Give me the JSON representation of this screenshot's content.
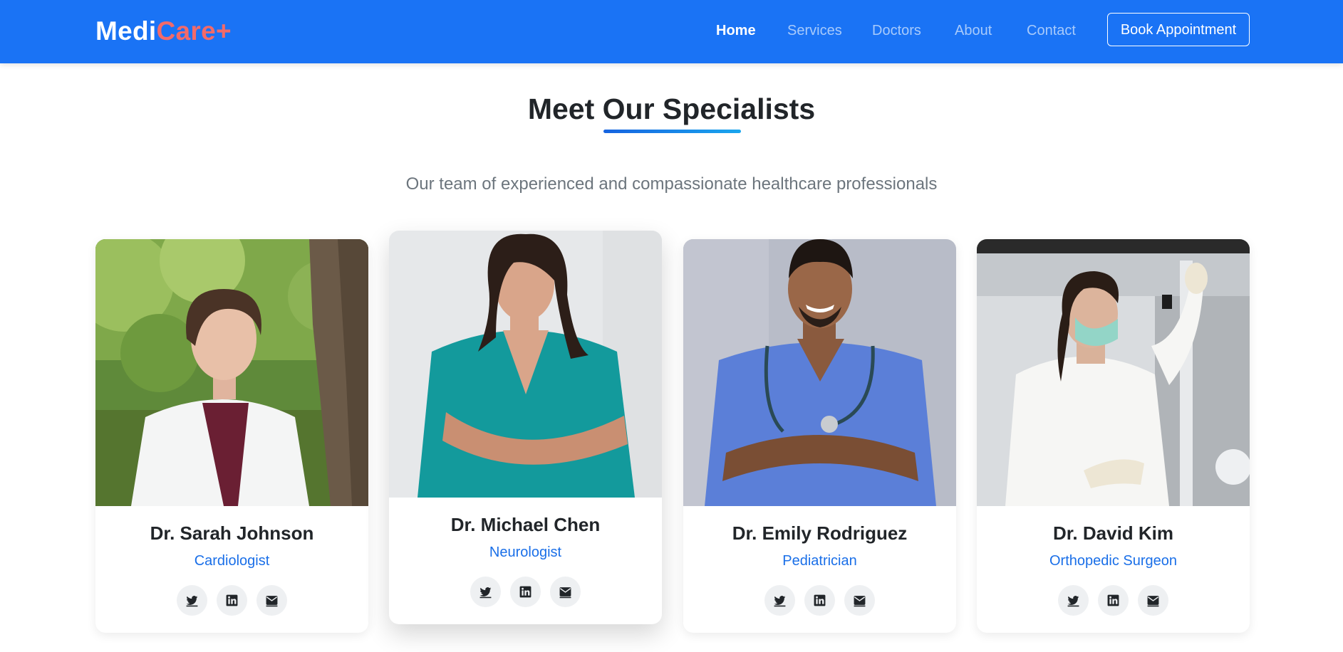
{
  "brand": {
    "part1": "Medi",
    "part2": "Care+"
  },
  "nav": {
    "links": [
      {
        "label": "Home",
        "active": true
      },
      {
        "label": "Services",
        "active": false
      },
      {
        "label": "Doctors",
        "active": false
      },
      {
        "label": "About",
        "active": false
      },
      {
        "label": "Contact",
        "active": false
      }
    ],
    "cta_label": "Book Appointment"
  },
  "section": {
    "title": "Meet Our Specialists",
    "subtitle": "Our team of experienced and compassionate healthcare professionals"
  },
  "doctors": [
    {
      "name": "Dr. Sarah Johnson",
      "role": "Cardiologist",
      "photo": "doctor-photo-outdoor-white-coat"
    },
    {
      "name": "Dr. Michael Chen",
      "role": "Neurologist",
      "photo": "doctor-photo-teal-scrubs"
    },
    {
      "name": "Dr. Emily Rodriguez",
      "role": "Pediatrician",
      "photo": "doctor-photo-blue-scrubs-stethoscope"
    },
    {
      "name": "Dr. David Kim",
      "role": "Orthopedic Surgeon",
      "photo": "doctor-photo-lab-mask"
    }
  ],
  "social_icons": [
    "twitter-icon",
    "linkedin-icon",
    "envelope-icon"
  ],
  "colors": {
    "navbar": "#1a73f5",
    "brand_accent": "#f26a6a",
    "role_text": "#1a6fe8"
  }
}
